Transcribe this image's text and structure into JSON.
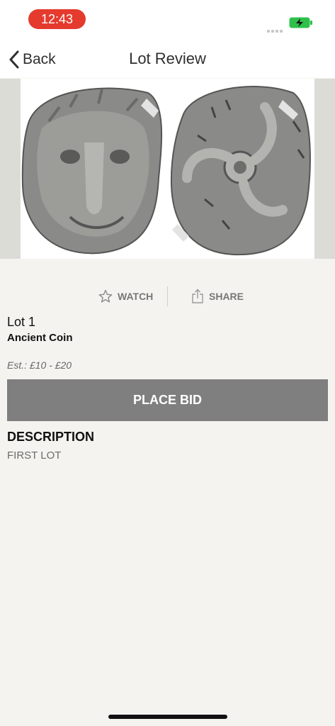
{
  "status_bar": {
    "time": "12:43",
    "time_pill_color": "#e53a2e",
    "battery_color": "#2ec04a"
  },
  "nav": {
    "back_label": "Back",
    "title": "Lot Review"
  },
  "lot_image": {
    "alt": "Ancient coin obverse and reverse"
  },
  "actions": {
    "watch_label": "WATCH",
    "share_label": "SHARE"
  },
  "lot": {
    "number": "Lot 1",
    "title": "Ancient Coin",
    "estimate": "Est.: £10 - £20"
  },
  "bid_button": {
    "label": "PLACE BID",
    "color": "#7f7f7f"
  },
  "description": {
    "heading": "DESCRIPTION",
    "text": "FIRST LOT"
  }
}
